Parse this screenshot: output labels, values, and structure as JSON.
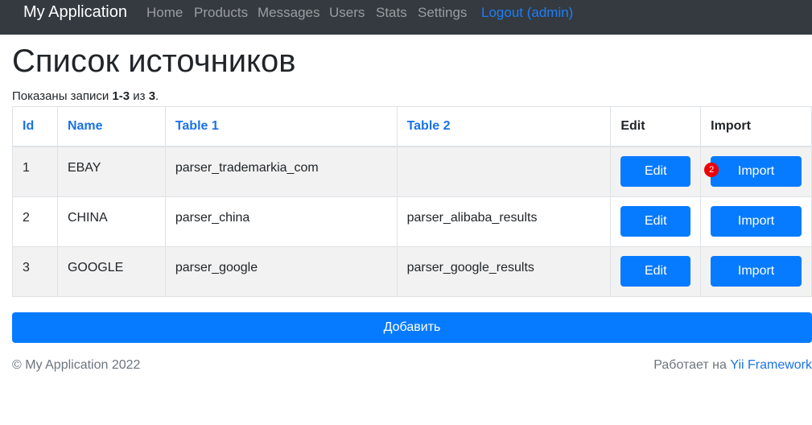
{
  "navbar": {
    "brand": "My Application",
    "items": [
      "Home",
      "Products",
      "Messages",
      "Users",
      "Stats",
      "Settings"
    ],
    "logout": "Logout (admin)"
  },
  "page": {
    "title": "Список источников",
    "summary_prefix": "Показаны записи ",
    "summary_range": "1-3",
    "summary_mid": " из ",
    "summary_total": "3",
    "summary_suffix": "."
  },
  "table": {
    "headers": [
      "Id",
      "Name",
      "Table 1",
      "Table 2",
      "Edit",
      "Import"
    ],
    "rows": [
      {
        "id": "1",
        "name": "EBAY",
        "table1": "parser_trademarkia_com",
        "table2": "",
        "edit": "Edit",
        "import": "Import"
      },
      {
        "id": "2",
        "name": "CHINA",
        "table1": "parser_china",
        "table2": "parser_alibaba_results",
        "edit": "Edit",
        "import": "Import"
      },
      {
        "id": "3",
        "name": "GOOGLE",
        "table1": "parser_google",
        "table2": "parser_google_results",
        "edit": "Edit",
        "import": "Import"
      }
    ],
    "badge": "2"
  },
  "add_button": "Добавить",
  "footer": {
    "copyright": "© My Application 2022",
    "powered_prefix": "Работает на ",
    "powered_link": "Yii Framework"
  },
  "colors": {
    "navbar": "#343a40",
    "primary": "#077bff",
    "link": "#1a73e8",
    "badge": "#ee0000"
  }
}
